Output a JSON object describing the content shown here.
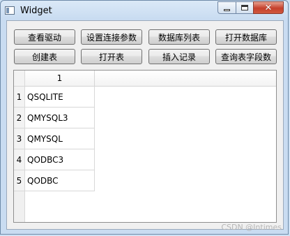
{
  "window": {
    "title": "Widget",
    "close_symbol": "✕"
  },
  "buttons": {
    "row1": [
      "查看驱动",
      "设置连接参数",
      "数据库列表",
      "打开数据库"
    ],
    "row2": [
      "创建表",
      "打开表",
      "插入记录",
      "查询表字段数"
    ]
  },
  "table": {
    "column_headers": [
      "1"
    ],
    "rows": [
      {
        "index": "1",
        "value": "QSQLITE"
      },
      {
        "index": "2",
        "value": "QMYSQL3"
      },
      {
        "index": "3",
        "value": "QMYSQL"
      },
      {
        "index": "4",
        "value": "QODBC3"
      },
      {
        "index": "5",
        "value": "QODBC"
      }
    ]
  },
  "watermark": "CSDN @Intimes"
}
